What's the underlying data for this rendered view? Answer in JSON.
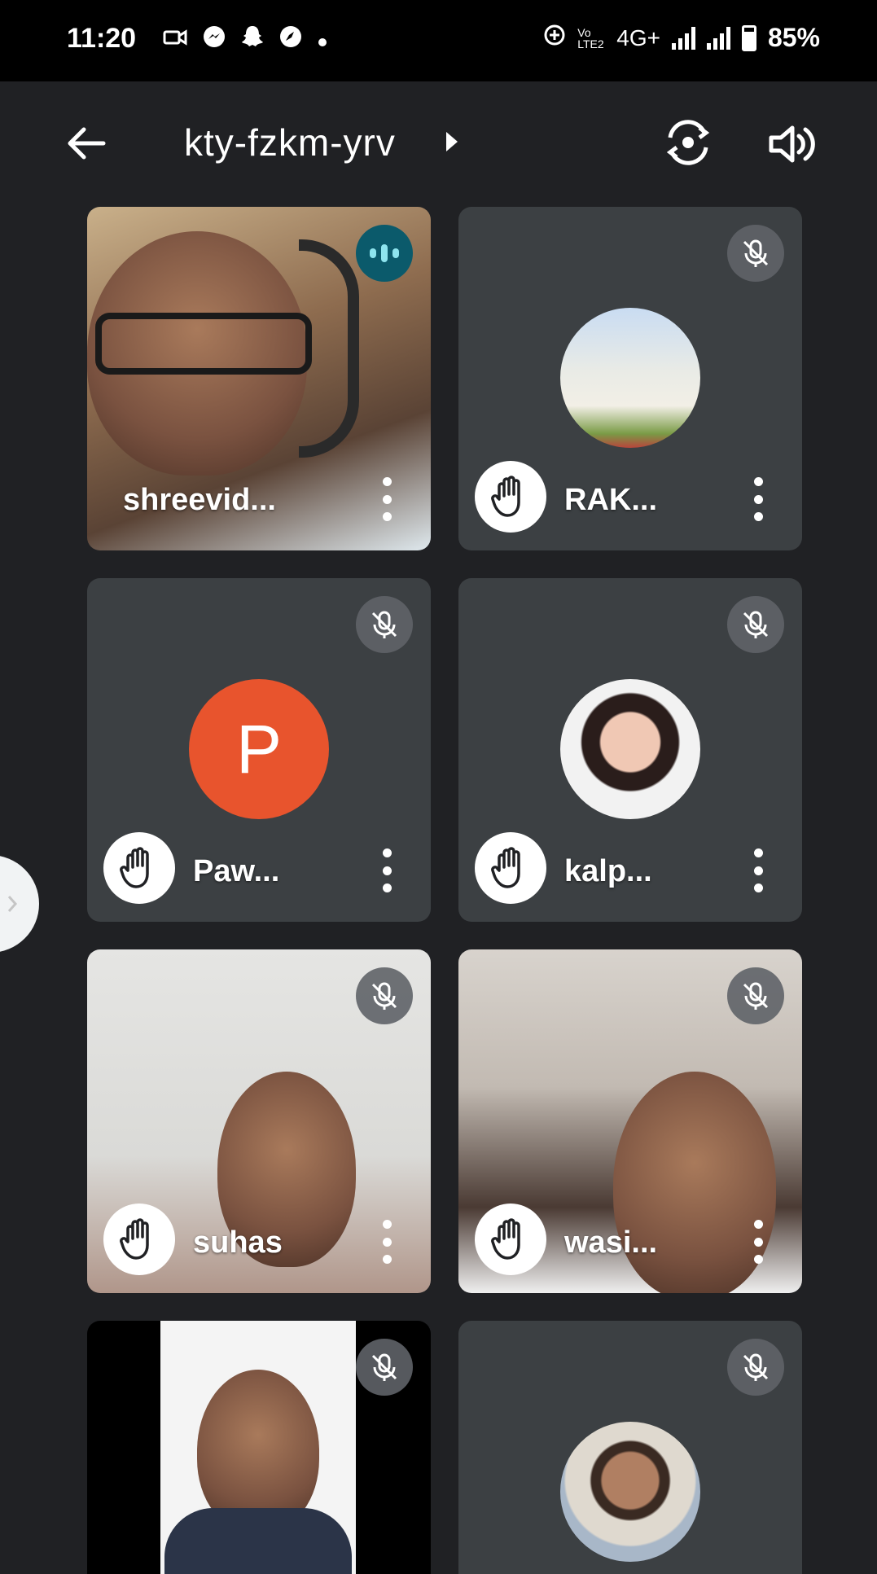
{
  "status": {
    "time": "11:20",
    "network": "4G+",
    "volte": "Vo LTE2",
    "battery": "85%"
  },
  "appbar": {
    "meeting_code": "kty-fzkm-yrv"
  },
  "participants": [
    {
      "name": "shreevid...",
      "state": "speaking"
    },
    {
      "name": "RAK...",
      "state": "muted",
      "hand": true
    },
    {
      "name": "Paw...",
      "state": "muted",
      "hand": true,
      "initial": "P",
      "avatar_color": "#e8542d"
    },
    {
      "name": "kalp...",
      "state": "muted",
      "hand": true
    },
    {
      "name": "suhas",
      "state": "muted",
      "hand": true
    },
    {
      "name": "wasi...",
      "state": "muted",
      "hand": true
    },
    {
      "name": "",
      "state": "muted"
    },
    {
      "name": "",
      "state": "muted"
    }
  ]
}
